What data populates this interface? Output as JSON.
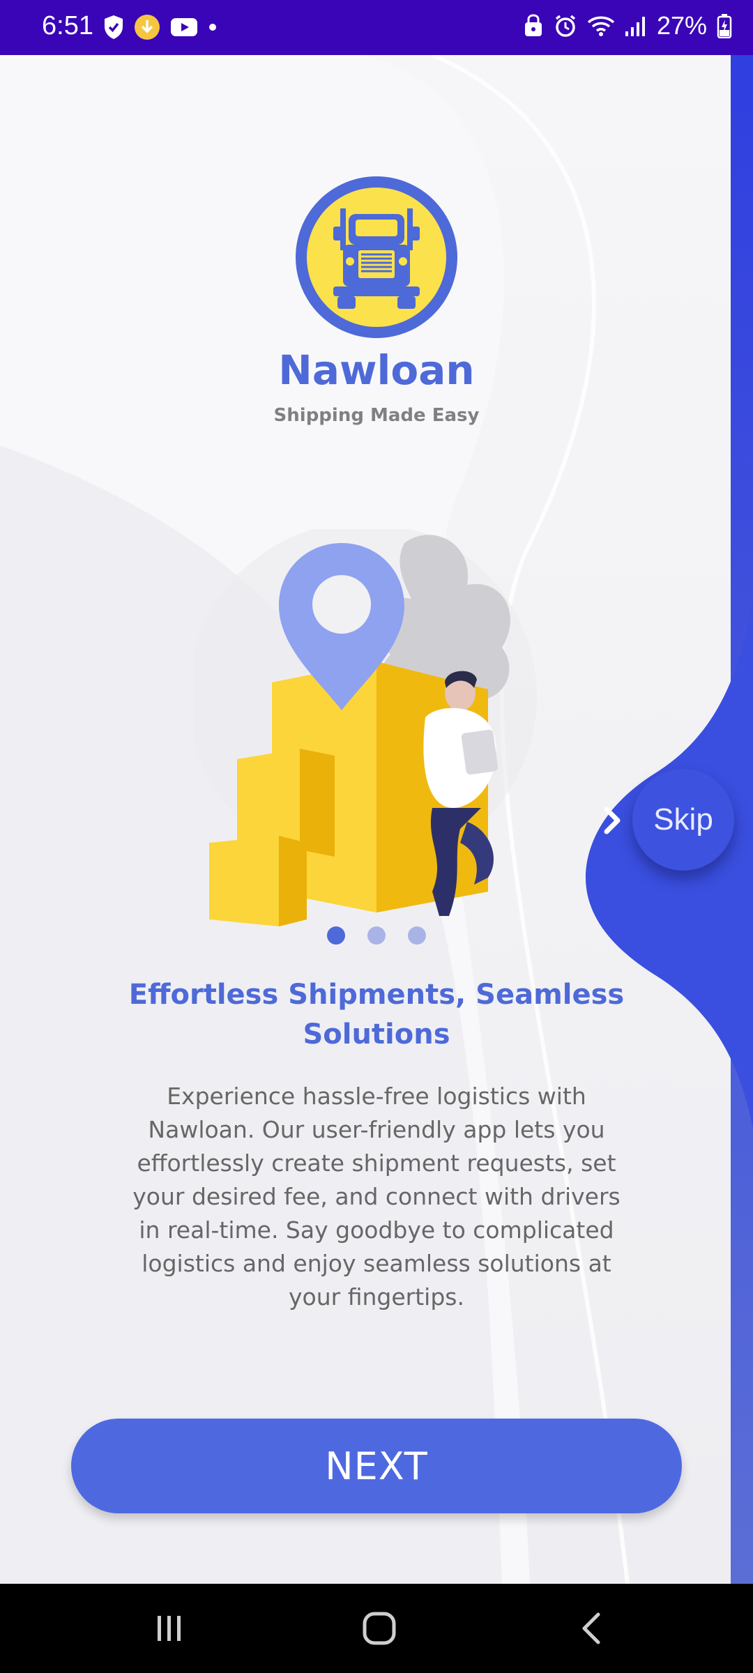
{
  "status_bar": {
    "time": "6:51",
    "battery_percent": "27%",
    "left_icons": [
      "shield-check-icon",
      "download-badge-icon",
      "youtube-icon",
      "dot-icon"
    ],
    "right_icons": [
      "lock-save-icon",
      "alarm-icon",
      "wifi-icon",
      "signal-icon",
      "battery-charging-icon"
    ]
  },
  "brand": {
    "name": "Nawloan",
    "tagline": "Shipping Made Easy",
    "logo_icon": "truck-icon"
  },
  "onboarding": {
    "illustration": "boxes-location-pin-person-illustration",
    "page_indicator": {
      "total": 3,
      "active": 1
    },
    "headline": "Effortless Shipments, Seamless Solutions",
    "body": "Experience hassle-free logistics with Nawloan. Our user-friendly app lets you effortlessly create shipment requests, set your desired fee, and connect with drivers in real-time. Say goodbye to complicated logistics and enjoy seamless solutions at your fingertips."
  },
  "skip": {
    "label": "Skip"
  },
  "next": {
    "label": "NEXT"
  },
  "nav": {
    "icons": [
      "recent-apps-icon",
      "home-icon",
      "back-icon"
    ]
  },
  "colors": {
    "status_bar": "#3a05b7",
    "accent": "#4e69d8",
    "button": "#4e69e0",
    "logo_yellow": "#fbe14b"
  }
}
